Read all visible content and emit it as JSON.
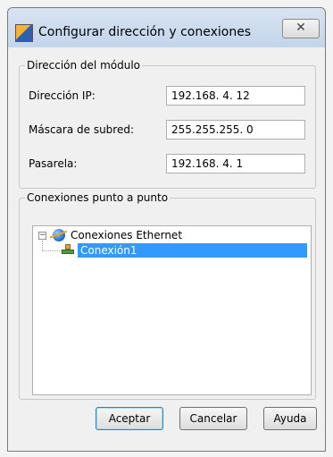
{
  "dialog": {
    "title": "Configurar dirección y conexiones",
    "close_glyph": "✕"
  },
  "module_address": {
    "legend": "Dirección del módulo",
    "ip_label": "Dirección IP:",
    "ip_value": "192.168.  4. 12",
    "mask_label": "Máscara de subred:",
    "mask_value": "255.255.255.  0",
    "gateway_label": "Pasarela:",
    "gateway_value": "192.168.  4.  1"
  },
  "connections": {
    "legend": "Conexiones punto a punto",
    "tree": {
      "root_label": "Conexiones Ethernet",
      "expander_glyph": "−",
      "children": [
        {
          "label": "Conexión1",
          "selected": true
        }
      ]
    }
  },
  "buttons": {
    "accept": "Aceptar",
    "cancel": "Cancelar",
    "help": "Ayuda"
  },
  "colors": {
    "selection": "#3399ff",
    "titlebar": "#c3d5ea",
    "dialog_bg": "#f0f0f0"
  },
  "icons": {
    "title": "app-icon",
    "root": "globe-icon",
    "child": "network-connection-icon",
    "close": "close-icon"
  }
}
